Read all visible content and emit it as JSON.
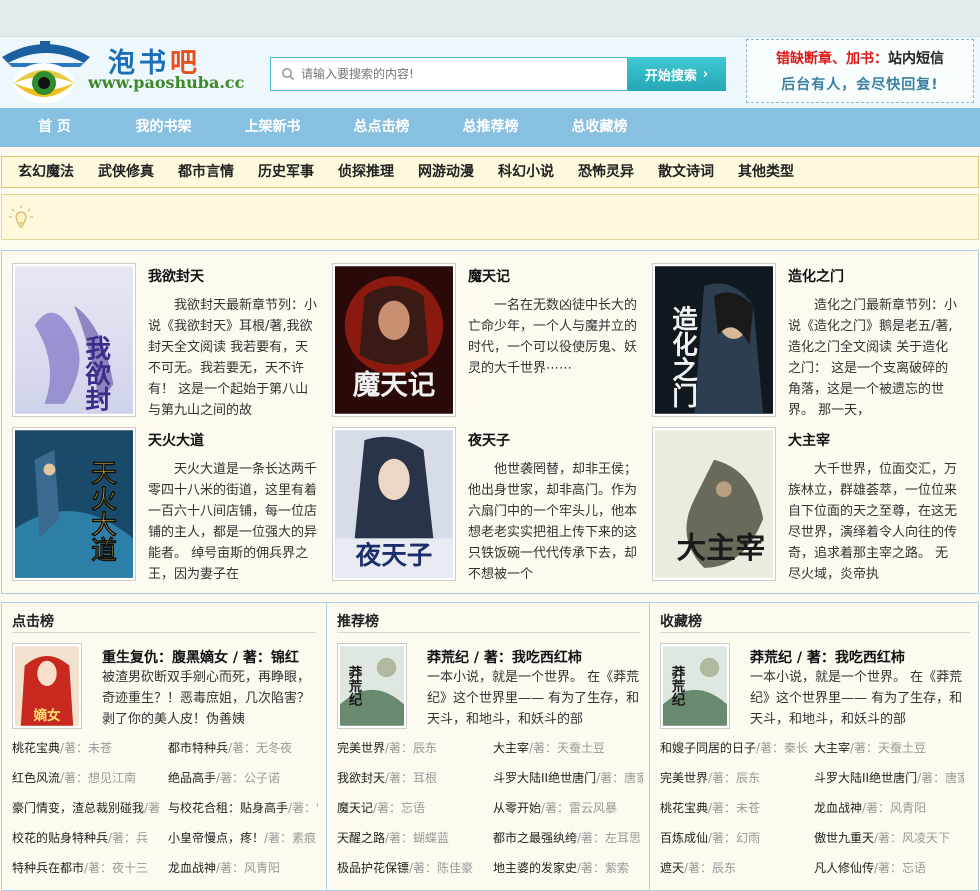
{
  "site": {
    "logo_text_main": "泡书",
    "logo_text_accent": "吧",
    "logo_url": "www.paoshuba.cc"
  },
  "search": {
    "placeholder": "请输入要搜索的内容!",
    "button_label": "开始搜索",
    "button_arrow": "›"
  },
  "notice": {
    "line1_red": "错缺断章、加书：",
    "line1_dark": "站内短信",
    "line2": "后台有人，会尽快回复!"
  },
  "nav": [
    "首 页",
    "我的书架",
    "上架新书",
    "总点击榜",
    "总推荐榜",
    "总收藏榜"
  ],
  "categories": [
    "玄幻魔法",
    "武侠修真",
    "都市言情",
    "历史军事",
    "侦探推理",
    "网游动漫",
    "科幻小说",
    "恐怖灵异",
    "散文诗词",
    "其他类型"
  ],
  "featured": [
    {
      "title": "我欲封天",
      "cover_text": "我欲封天",
      "desc": "我欲封天最新章节列：小说《我欲封天》耳根/著,我欲封天全文阅读 我若要有，天不可无。我若要无，天不许有！ 这是一个起始于第八山与第九山之间的故"
    },
    {
      "title": "魔天记",
      "cover_text": "魔天记",
      "desc": "一名在无数凶徒中长大的亡命少年，一个人与魔并立的时代，一个可以役使厉鬼、妖灵的大千世界⋯⋯"
    },
    {
      "title": "造化之门",
      "cover_text": "造化之门",
      "desc": "造化之门最新章节列：小说《造化之门》鹅是老五/著,造化之门全文阅读 关于造化之门： 这是一个支离破碎的角落，这是一个被遗忘的世界。 那一天，"
    },
    {
      "title": "天火大道",
      "cover_text": "天火大道",
      "desc": "天火大道是一条长达两千零四十八米的街道，这里有着一百六十八间店铺，每一位店铺的主人，都是一位强大的异能者。 绰号亩斯的佣兵界之王，因为妻子在"
    },
    {
      "title": "夜天子",
      "cover_text": "夜天子",
      "desc": "他世袭罔替，却非王侯；他出身世家，却非高门。作为六扇门中的一个牢头儿，他本想老老实实把祖上传下来的这只铁饭碗一代代传承下去，却不想被一个"
    },
    {
      "title": "大主宰",
      "cover_text": "大主宰",
      "desc": "大千世界，位面交汇，万族林立，群雄荟萃，一位位来自下位面的天之至尊，在这无尽世界，演绎着令人向往的传奇，追求着那主宰之路。 无尽火域，炎帝执"
    }
  ],
  "rankings": [
    {
      "heading": "点击榜",
      "top": {
        "title": "重生复仇：腹黑嫡女 / 著：锦红",
        "cover_text": "嫡女",
        "desc": "被渣男砍断双手剜心而死，再睁眼，奇迹重生？！恶毒庶姐，几次陷害？剥了你的美人皮！伪善姨"
      },
      "items": [
        {
          "name": "桃花宝典",
          "author": "/著：未苍"
        },
        {
          "name": "都市特种兵",
          "author": "/著：无冬夜"
        },
        {
          "name": "红色风流",
          "author": "/著：想见江南"
        },
        {
          "name": "绝品高手",
          "author": "/著：公子诺"
        },
        {
          "name": "豪门情变，渣总裁别碰我",
          "author": "/著：凌草丽"
        },
        {
          "name": "与校花合租：贴身高手",
          "author": "/著：雷霆"
        },
        {
          "name": "校花的贴身特种兵",
          "author": "/著：兵"
        },
        {
          "name": "小皇帝慢点，疼！",
          "author": "/著：素痕"
        },
        {
          "name": "特种兵在都市",
          "author": "/著：夜十三"
        },
        {
          "name": "龙血战神",
          "author": "/著：风青阳"
        }
      ]
    },
    {
      "heading": "推荐榜",
      "top": {
        "title": "莽荒纪 / 著：我吃西红柿",
        "cover_text": "莽荒纪",
        "desc": "一本小说，就是一个世界。 在《莽荒纪》这个世界里—— 有为了生存，和天斗，和地斗，和妖斗的部"
      },
      "items": [
        {
          "name": "完美世界",
          "author": "/著：辰东"
        },
        {
          "name": "大主宰",
          "author": "/著：天蚕土豆"
        },
        {
          "name": "我欲封天",
          "author": "/著：耳根"
        },
        {
          "name": "斗罗大陆II绝世唐门",
          "author": "/著：唐家三少"
        },
        {
          "name": "魔天记",
          "author": "/著：忘语"
        },
        {
          "name": "从零开始",
          "author": "/著：雷云风暴"
        },
        {
          "name": "天醒之路",
          "author": "/著：蝴蝶蓝"
        },
        {
          "name": "都市之最强纨绔",
          "author": "/著：左耳思"
        },
        {
          "name": "极品护花保镖",
          "author": "/著：陈佳豪"
        },
        {
          "name": "地主婆的发家史",
          "author": "/著：紫索"
        }
      ]
    },
    {
      "heading": "收藏榜",
      "top": {
        "title": "莽荒纪 / 著：我吃西红柿",
        "cover_text": "莽荒纪",
        "desc": "一本小说，就是一个世界。 在《莽荒纪》这个世界里—— 有为了生存，和天斗，和地斗，和妖斗的部"
      },
      "items": [
        {
          "name": "和嫂子同居的日子",
          "author": "/著：秦长"
        },
        {
          "name": "大主宰",
          "author": "/著：天蚕土豆"
        },
        {
          "name": "完美世界",
          "author": "/著：辰东"
        },
        {
          "name": "斗罗大陆II绝世唐门",
          "author": "/著：唐家三少"
        },
        {
          "name": "桃花宝典",
          "author": "/著：未苍"
        },
        {
          "name": "龙血战神",
          "author": "/著：风青阳"
        },
        {
          "name": "百炼成仙",
          "author": "/著：幻雨"
        },
        {
          "name": "傲世九重天",
          "author": "/著：风凌天下"
        },
        {
          "name": "遮天",
          "author": "/著：辰东"
        },
        {
          "name": "凡人修仙传",
          "author": "/著：忘语"
        }
      ]
    }
  ],
  "icons": {
    "logo": "house-eye-logo-icon",
    "search": "search-icon",
    "tip": "lightbulb-icon"
  },
  "colors": {
    "nav_bg": "#87c0e0",
    "search_btn": "#25a7b6",
    "notice_red": "#e01818",
    "category_bg": "#fef8dd"
  }
}
